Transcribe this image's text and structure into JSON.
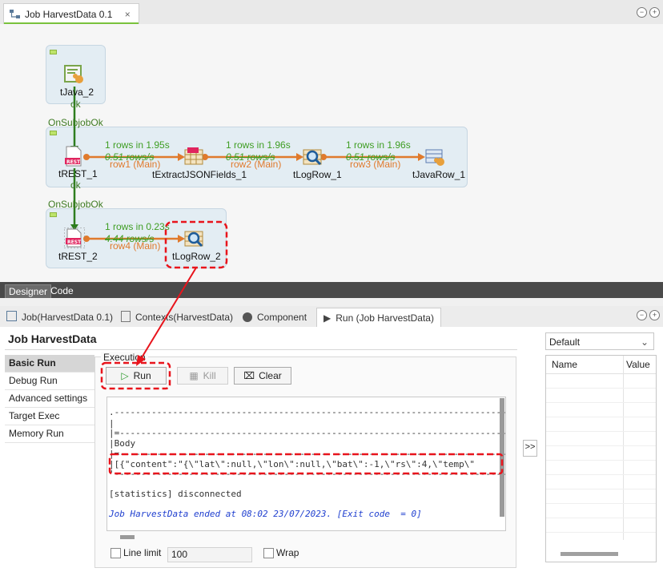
{
  "editor": {
    "tab_title": "Job HarvestData 0.1",
    "tab_close": "×"
  },
  "canvas": {
    "components": {
      "tjava2": "tJava_2",
      "trest1": "tREST_1",
      "textract": "tExtractJSONFields_1",
      "tlogrow1": "tLogRow_1",
      "tjavarow1": "tJavaRow_1",
      "trest2": "tREST_2",
      "tlogrow2": "tLogRow_2"
    },
    "triggers": {
      "ok1": "ok",
      "onsubjob1": "OnSubjobOk",
      "ok2": "ok",
      "onsubjob2": "OnSubjobOk"
    },
    "flows": {
      "row1": {
        "stat": "1 rows in 1.95s",
        "rate": "0.51 rows/s",
        "label": "row1 (Main)"
      },
      "row2": {
        "stat": "1 rows in 1.96s",
        "rate": "0.51 rows/s",
        "label": "row2 (Main)"
      },
      "row3": {
        "stat": "1 rows in 1.96s",
        "rate": "0.51 rows/s",
        "label": "row3 (Main)"
      },
      "row4": {
        "stat": "1 rows in 0.23s",
        "rate": "4.44 rows/s",
        "label": "row4 (Main)"
      }
    }
  },
  "editor_bottom_tabs": [
    "Designer",
    "Code"
  ],
  "view_tabs": {
    "job": "Job(HarvestData 0.1)",
    "contexts": "Contexts(HarvestData)",
    "component": "Component",
    "run": "Run (Job HarvestData)"
  },
  "run_panel": {
    "title": "Job HarvestData",
    "nav": [
      "Basic Run",
      "Debug Run",
      "Advanced settings",
      "Target Exec",
      "Memory Run"
    ],
    "execution_label": "Execution",
    "buttons": {
      "run": "Run",
      "kill": "Kill",
      "clear": "Clear"
    },
    "console_lines": {
      "l1": ".--------------------------------------------------------------------------",
      "l2": "|",
      "l3": "|=-------------------------------------------------------------------------",
      "l4": "|Body",
      "l5": "|=-------------------------------------------------------------------------",
      "l6": "|[{\"content\":\"{\\\"lat\\\":null,\\\"lon\\\":null,\\\"bat\\\":-1,\\\"rs\\\":4,\\\"temp\\\"",
      "l7": "'--------------------------------------------------------------------------",
      "l8": "[statistics] disconnected",
      "l9": "Job HarvestData ended at 08:02 23/07/2023. [Exit code  = 0]"
    },
    "line_limit_label": "Line limit",
    "line_limit_value": "100",
    "wrap_label": "Wrap",
    "expand_label": ">>"
  },
  "context_panel": {
    "selected": "Default",
    "columns": [
      "Name",
      "Value"
    ]
  },
  "colors": {
    "annotation": "#e8141c",
    "flow": "#e07a2c",
    "trigger": "#2e7d1e",
    "stat": "#3f9e23"
  }
}
